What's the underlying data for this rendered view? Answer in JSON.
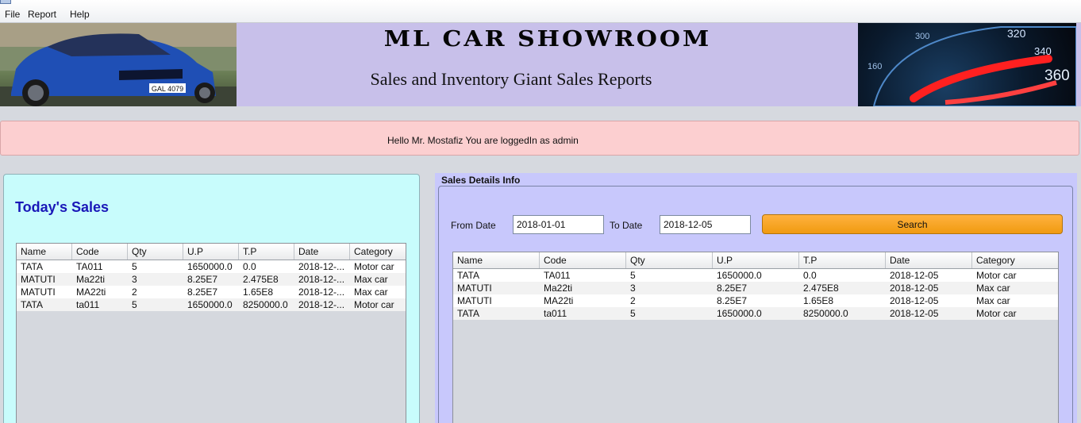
{
  "menu": [
    "File",
    "Report",
    "Help"
  ],
  "banner": {
    "title": "ML CAR SHOWROOM",
    "subtitle": "Sales and Inventory Giant Sales Reports",
    "speedometer_labels": [
      "360",
      "340",
      "320",
      "300",
      "160"
    ]
  },
  "welcome": "Hello Mr. Mostafiz You are loggedIn as admin",
  "today": {
    "title": "Today's Sales",
    "columns": [
      "Name",
      "Code",
      "Qty",
      "U.P",
      "T.P",
      "Date",
      "Category"
    ],
    "rows": [
      [
        "TATA",
        "TA011",
        "5",
        "1650000.0",
        "0.0",
        "2018-12-...",
        "Motor car"
      ],
      [
        "MATUTI",
        "Ma22ti",
        "3",
        "8.25E7",
        "2.475E8",
        "2018-12-...",
        "Max car"
      ],
      [
        "MATUTI",
        "MA22ti",
        "2",
        "8.25E7",
        "1.65E8",
        "2018-12-...",
        "Max car"
      ],
      [
        "TATA",
        "ta011",
        "5",
        "1650000.0",
        "8250000.0",
        "2018-12-...",
        "Motor car"
      ]
    ]
  },
  "details": {
    "title": "Sales Details Info",
    "from_label": "From Date",
    "from_value": "2018-01-01",
    "to_label": "To Date",
    "to_value": "2018-12-05",
    "search_label": "Search",
    "columns": [
      "Name",
      "Code",
      "Qty",
      "U.P",
      "T.P",
      "Date",
      "Category"
    ],
    "rows": [
      [
        "TATA",
        "TA011",
        "5",
        "1650000.0",
        "0.0",
        "2018-12-05",
        "Motor car"
      ],
      [
        "MATUTI",
        "Ma22ti",
        "3",
        "8.25E7",
        "2.475E8",
        "2018-12-05",
        "Max car"
      ],
      [
        "MATUTI",
        "MA22ti",
        "2",
        "8.25E7",
        "1.65E8",
        "2018-12-05",
        "Max car"
      ],
      [
        "TATA",
        "ta011",
        "5",
        "1650000.0",
        "8250000.0",
        "2018-12-05",
        "Motor car"
      ]
    ]
  },
  "colors": {
    "banner": "#c8c0ea",
    "welcome_bg": "#fccfd0",
    "today_panel": "#c8fcfc",
    "today_title": "#1a18b8",
    "details_panel": "#c8c8fc",
    "search_button": "#f8a51f"
  },
  "car_plate": "GAL 4079"
}
